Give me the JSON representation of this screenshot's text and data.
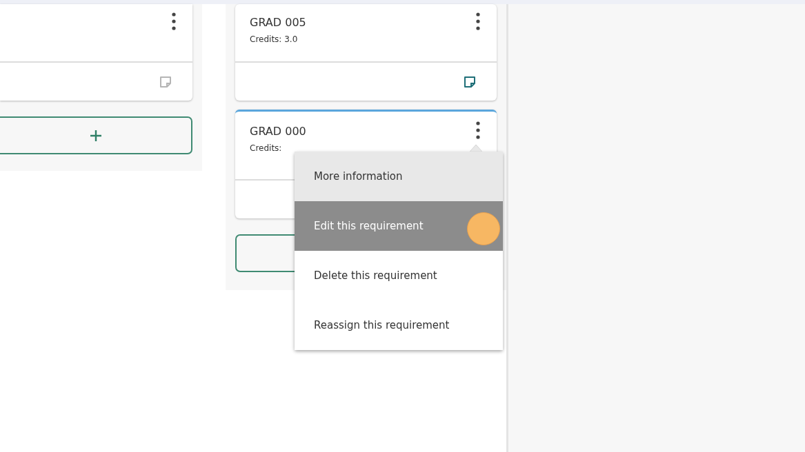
{
  "columns": [
    {
      "cards": [
        {
          "has_note": false,
          "selected": false
        }
      ]
    },
    {
      "cards": [
        {
          "title": "GRAD 005",
          "credits": "Credits: 3.0",
          "has_note": true,
          "selected": false
        },
        {
          "title": "GRAD 000",
          "credits": "Credits:",
          "selected": true,
          "menu_open": true
        }
      ]
    }
  ],
  "menu": {
    "items": [
      {
        "label": "More information",
        "shaded": true,
        "selected": false
      },
      {
        "label": "Edit this requirement",
        "shaded": true,
        "selected": true
      },
      {
        "label": "Delete this requirement",
        "shaded": false,
        "selected": false
      },
      {
        "label": "Reassign this requirement",
        "shaded": false,
        "selected": false
      }
    ]
  }
}
